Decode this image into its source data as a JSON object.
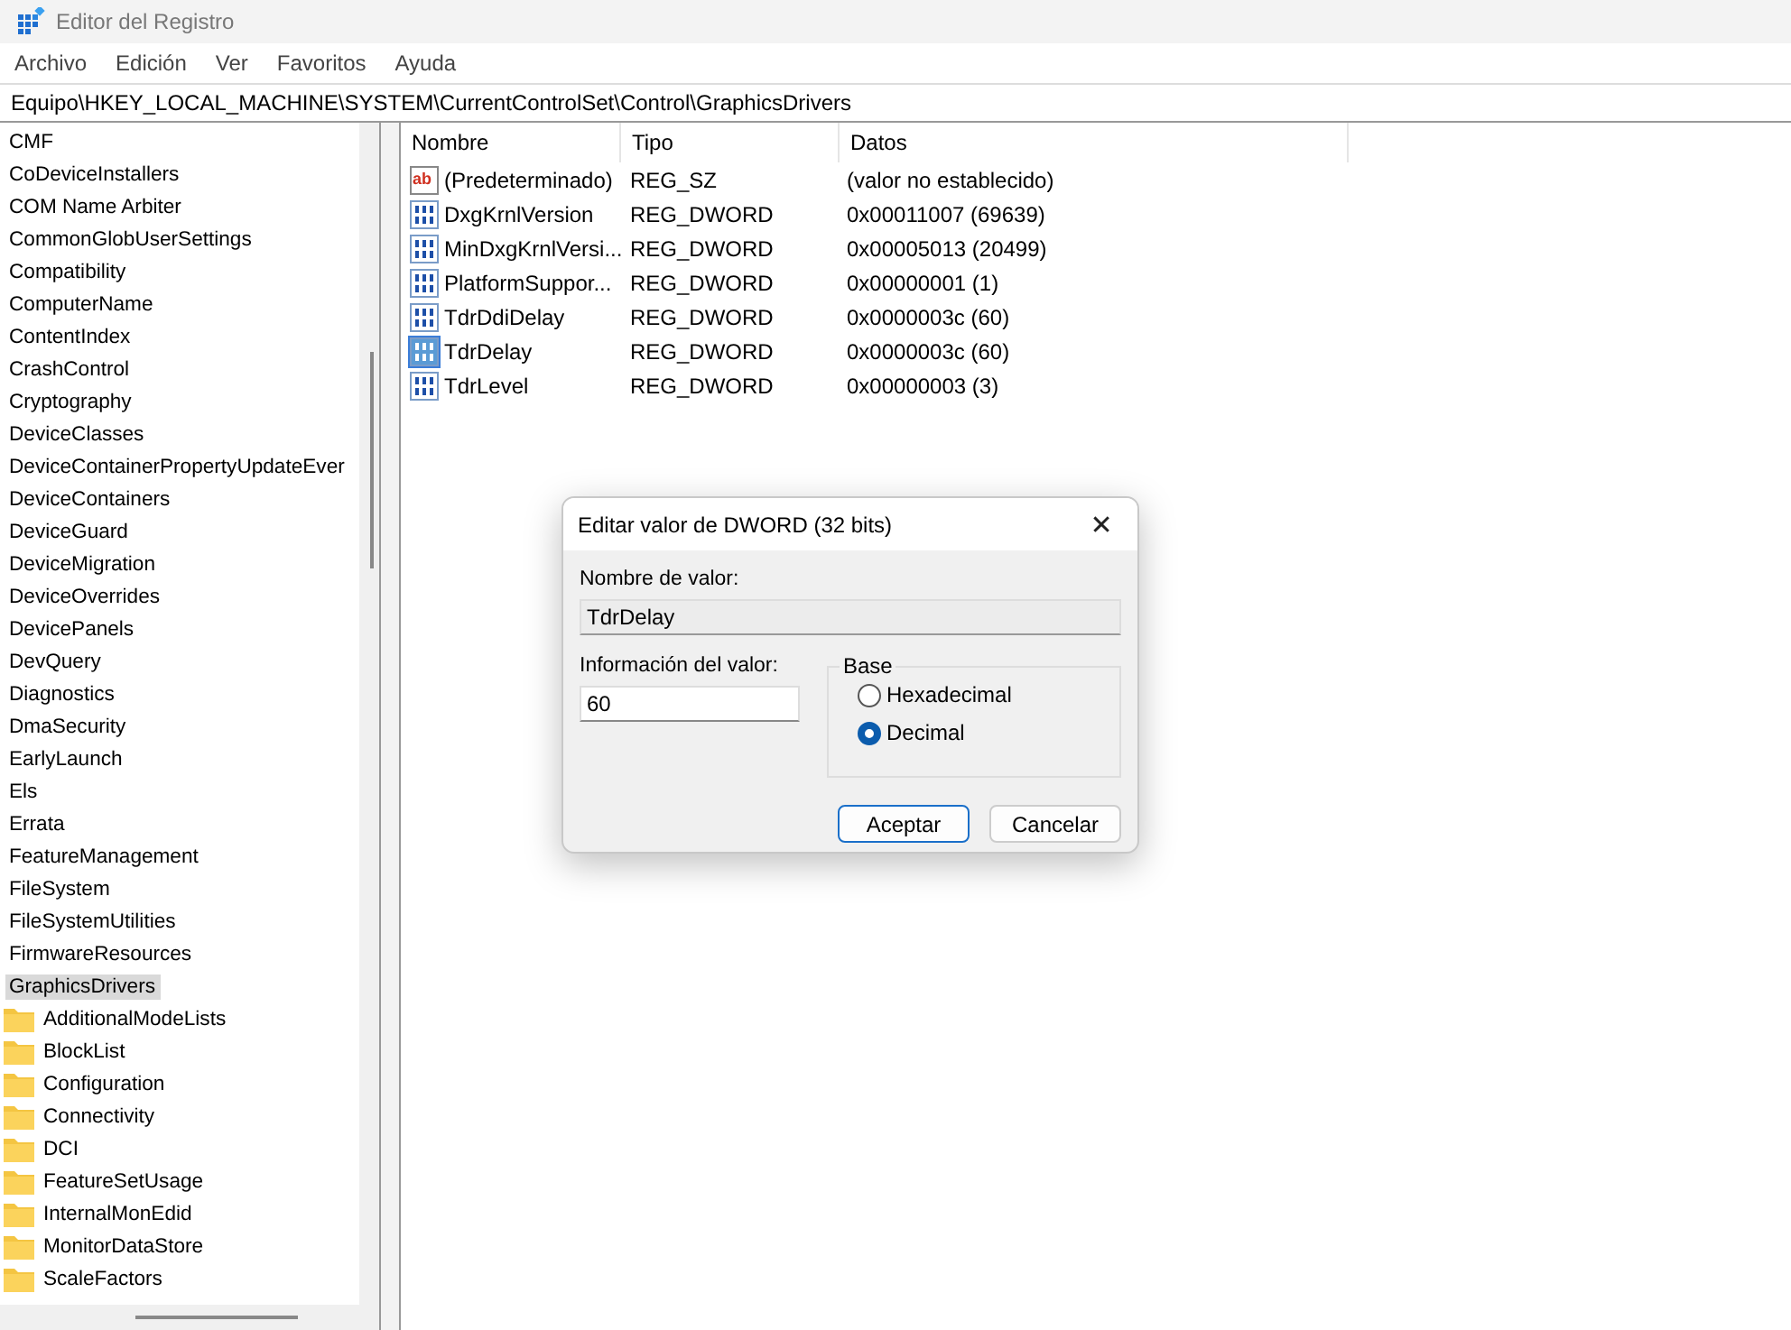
{
  "window": {
    "title": "Editor del Registro"
  },
  "menu": [
    "Archivo",
    "Edición",
    "Ver",
    "Favoritos",
    "Ayuda"
  ],
  "address": "Equipo\\HKEY_LOCAL_MACHINE\\SYSTEM\\CurrentControlSet\\Control\\GraphicsDrivers",
  "tree": [
    {
      "label": "CMF",
      "selected": false
    },
    {
      "label": "CoDeviceInstallers",
      "selected": false
    },
    {
      "label": "COM Name Arbiter",
      "selected": false
    },
    {
      "label": "CommonGlobUserSettings",
      "selected": false
    },
    {
      "label": "Compatibility",
      "selected": false
    },
    {
      "label": "ComputerName",
      "selected": false
    },
    {
      "label": "ContentIndex",
      "selected": false
    },
    {
      "label": "CrashControl",
      "selected": false
    },
    {
      "label": "Cryptography",
      "selected": false
    },
    {
      "label": "DeviceClasses",
      "selected": false
    },
    {
      "label": "DeviceContainerPropertyUpdateEver",
      "selected": false
    },
    {
      "label": "DeviceContainers",
      "selected": false
    },
    {
      "label": "DeviceGuard",
      "selected": false
    },
    {
      "label": "DeviceMigration",
      "selected": false
    },
    {
      "label": "DeviceOverrides",
      "selected": false
    },
    {
      "label": "DevicePanels",
      "selected": false
    },
    {
      "label": "DevQuery",
      "selected": false
    },
    {
      "label": "Diagnostics",
      "selected": false
    },
    {
      "label": "DmaSecurity",
      "selected": false
    },
    {
      "label": "EarlyLaunch",
      "selected": false
    },
    {
      "label": "Els",
      "selected": false
    },
    {
      "label": "Errata",
      "selected": false
    },
    {
      "label": "FeatureManagement",
      "selected": false
    },
    {
      "label": "FileSystem",
      "selected": false
    },
    {
      "label": "FileSystemUtilities",
      "selected": false
    },
    {
      "label": "FirmwareResources",
      "selected": false
    },
    {
      "label": "GraphicsDrivers",
      "selected": true,
      "children": [
        {
          "label": "AdditionalModeLists",
          "selected": false
        },
        {
          "label": "BlockList",
          "selected": false
        },
        {
          "label": "Configuration",
          "selected": false
        },
        {
          "label": "Connectivity",
          "selected": false
        },
        {
          "label": "DCI",
          "selected": false
        },
        {
          "label": "FeatureSetUsage",
          "selected": false
        },
        {
          "label": "InternalMonEdid",
          "selected": false
        },
        {
          "label": "MonitorDataStore",
          "selected": false
        },
        {
          "label": "ScaleFactors",
          "selected": false
        }
      ]
    }
  ],
  "table": {
    "columns": [
      "Nombre",
      "Tipo",
      "Datos"
    ],
    "rows": [
      {
        "kind": "string",
        "icon": "ab",
        "name": "(Predeterminado)",
        "type": "REG_SZ",
        "data": "(valor no establecido)",
        "selected": false
      },
      {
        "kind": "dword",
        "name": "DxgKrnlVersion",
        "type": "REG_DWORD",
        "data": "0x00011007 (69639)",
        "selected": false
      },
      {
        "kind": "dword",
        "name": "MinDxgKrnlVersi...",
        "type": "REG_DWORD",
        "data": "0x00005013 (20499)",
        "selected": false
      },
      {
        "kind": "dword",
        "name": "PlatformSuppor...",
        "type": "REG_DWORD",
        "data": "0x00000001 (1)",
        "selected": false
      },
      {
        "kind": "dword",
        "name": "TdrDdiDelay",
        "type": "REG_DWORD",
        "data": "0x0000003c (60)",
        "selected": false
      },
      {
        "kind": "dword",
        "name": "TdrDelay",
        "type": "REG_DWORD",
        "data": "0x0000003c (60)",
        "selected": true
      },
      {
        "kind": "dword",
        "name": "TdrLevel",
        "type": "REG_DWORD",
        "data": "0x00000003 (3)",
        "selected": false
      }
    ]
  },
  "dialog": {
    "title": "Editar valor de DWORD (32 bits)",
    "close": "✕",
    "name_label": "Nombre de valor:",
    "name_value": "TdrDelay",
    "data_label": "Información del valor:",
    "data_value": "60",
    "base_label": "Base",
    "base_options": [
      {
        "label": "Hexadecimal",
        "selected": false
      },
      {
        "label": "Decimal",
        "selected": true
      }
    ],
    "buttons": [
      "Aceptar",
      "Cancelar"
    ]
  }
}
